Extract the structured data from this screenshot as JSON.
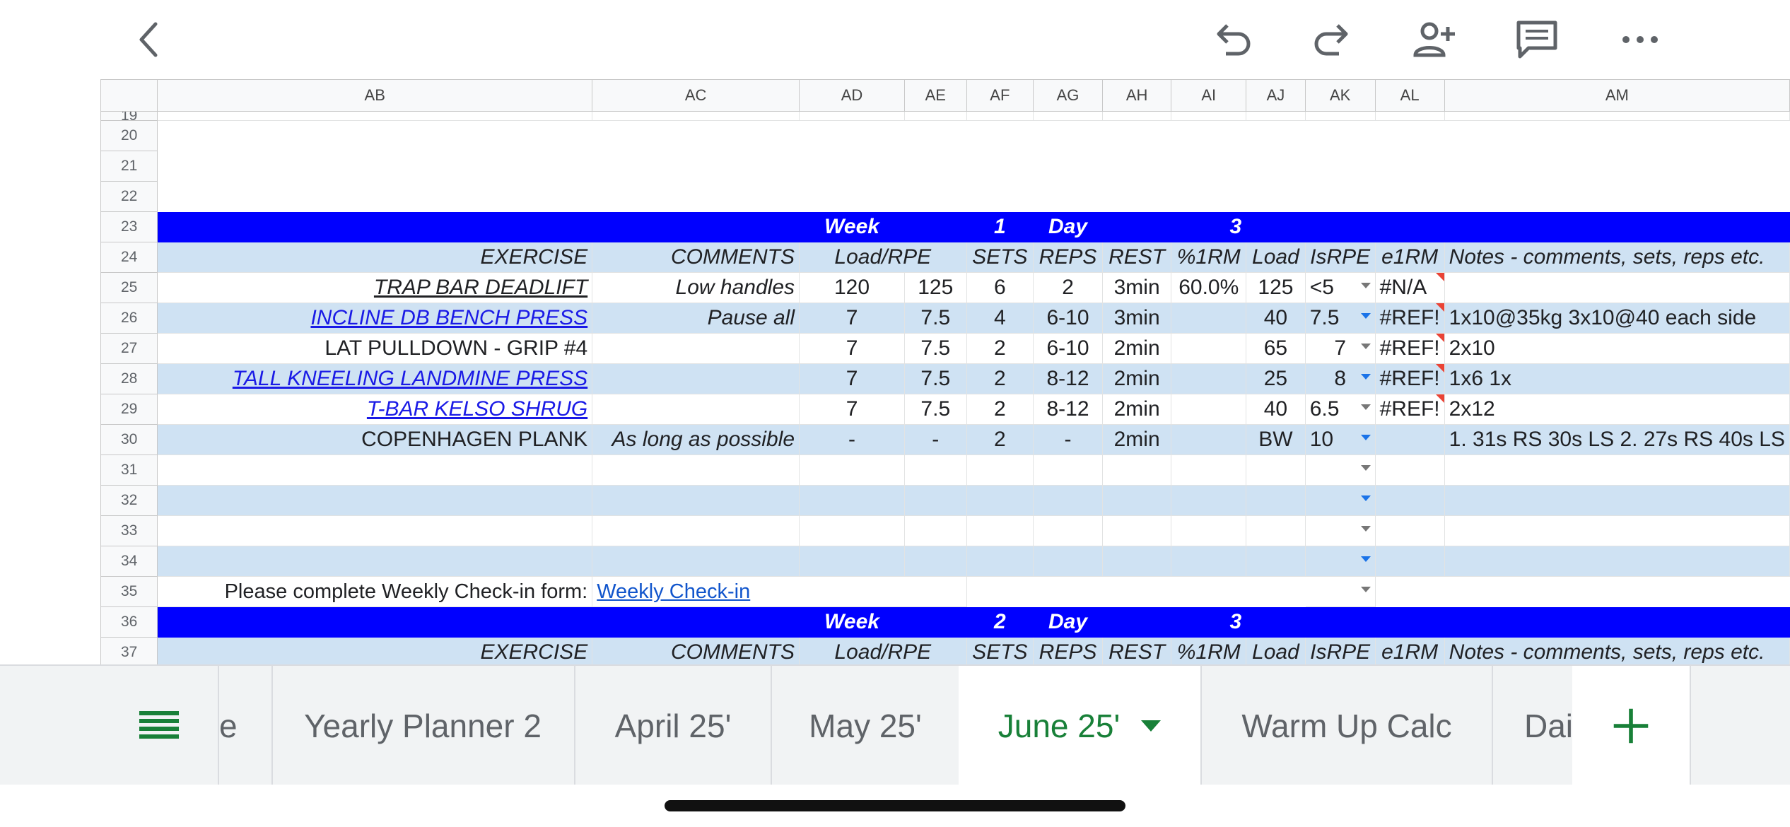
{
  "toolbar": {
    "icons": [
      "back-arrow-icon",
      "undo-icon",
      "redo-icon",
      "add-person-icon",
      "comment-icon",
      "more-icon"
    ]
  },
  "columns": [
    "AB",
    "AC",
    "AD",
    "AE",
    "AF",
    "AG",
    "AH",
    "AI",
    "AJ",
    "AK",
    "AL",
    "AM"
  ],
  "rows": {
    "r19": "19",
    "r20": "20",
    "r21": "21",
    "r22": "22",
    "r23": {
      "num": "23",
      "week_label": "Week",
      "week_num": "1",
      "day_label": "Day",
      "day_num": "3"
    },
    "r24": {
      "num": "24",
      "exercise": "EXERCISE",
      "comments": "COMMENTS",
      "load_rpe": "Load/RPE",
      "sets": "SETS",
      "reps": "REPS",
      "rest": "REST",
      "pct_1rm": "%1RM",
      "load": "Load",
      "is_rpe": "IsRPE",
      "e1rm": "e1RM",
      "notes": "Notes - comments, sets, reps etc."
    },
    "r25": {
      "num": "25",
      "exercise": "TRAP BAR DEADLIFT",
      "comments": "Low handles",
      "ad": "120",
      "ae": "125",
      "sets": "6",
      "reps": "2",
      "rest": "3min",
      "pct": "60.0%",
      "load": "125",
      "rpe": "<5",
      "e1rm": "#N/A",
      "notes": ""
    },
    "r26": {
      "num": "26",
      "exercise": "INCLINE DB BENCH PRESS",
      "comments": "Pause all",
      "ad": "7",
      "ae": "7.5",
      "sets": "4",
      "reps": "6-10",
      "rest": "3min",
      "pct": "",
      "load": "40",
      "rpe": "7.5",
      "e1rm": "#REF!",
      "notes": "1x10@35kg 3x10@40 each side"
    },
    "r27": {
      "num": "27",
      "exercise": "LAT PULLDOWN - GRIP #4",
      "comments": "",
      "ad": "7",
      "ae": "7.5",
      "sets": "2",
      "reps": "6-10",
      "rest": "2min",
      "pct": "",
      "load": "65",
      "rpe": "7",
      "e1rm": "#REF!",
      "notes": "2x10"
    },
    "r28": {
      "num": "28",
      "exercise": "TALL KNEELING LANDMINE PRESS",
      "comments": "",
      "ad": "7",
      "ae": "7.5",
      "sets": "2",
      "reps": "8-12",
      "rest": "2min",
      "pct": "",
      "load": "25",
      "rpe": "8",
      "e1rm": "#REF!",
      "notes": "1x6 1x"
    },
    "r29": {
      "num": "29",
      "exercise": "T-BAR KELSO SHRUG ",
      "comments": "",
      "ad": "7",
      "ae": "7.5",
      "sets": "2",
      "reps": "8-12",
      "rest": "2min",
      "pct": "",
      "load": "40",
      "rpe": "6.5",
      "e1rm": "#REF!",
      "notes": "2x12"
    },
    "r30": {
      "num": "30",
      "exercise": "COPENHAGEN PLANK",
      "comments": "As long as possible",
      "ad": "-",
      "ae": "-",
      "sets": "2",
      "reps": "-",
      "rest": "2min",
      "pct": "",
      "load": "BW",
      "rpe": "10",
      "e1rm": "",
      "notes": "1. 31s RS 30s LS 2. 27s RS 40s LS"
    },
    "r31": "31",
    "r32": "32",
    "r33": "33",
    "r34": "34",
    "r35": {
      "num": "35",
      "prompt": "Please complete Weekly Check-in form:",
      "link": "Weekly Check-in"
    },
    "r36": {
      "num": "36",
      "week_label": "Week",
      "week_num": "2",
      "day_label": "Day",
      "day_num": "3"
    },
    "r37": {
      "num": "37",
      "exercise": "EXERCISE",
      "comments": "COMMENTS",
      "load_rpe": "Load/RPE",
      "sets": "SETS",
      "reps": "REPS",
      "rest": "REST",
      "pct_1rm": "%1RM",
      "load": "Load",
      "is_rpe": "IsRPE",
      "e1rm": "e1RM",
      "notes": "Notes - comments, sets, reps etc."
    }
  },
  "tabs": {
    "partial_left": "e",
    "t1": "Yearly Planner 2",
    "t2": "April 25'",
    "t3": "May 25'",
    "t4": "June 25'",
    "t5": "Warm Up Calc",
    "t6": "Dai",
    "active": "June 25'"
  },
  "colors": {
    "week_bar": "#0000ff",
    "alt_row": "#cfe2f3",
    "active_tab": "#188038",
    "link": "#1a1ae6"
  }
}
